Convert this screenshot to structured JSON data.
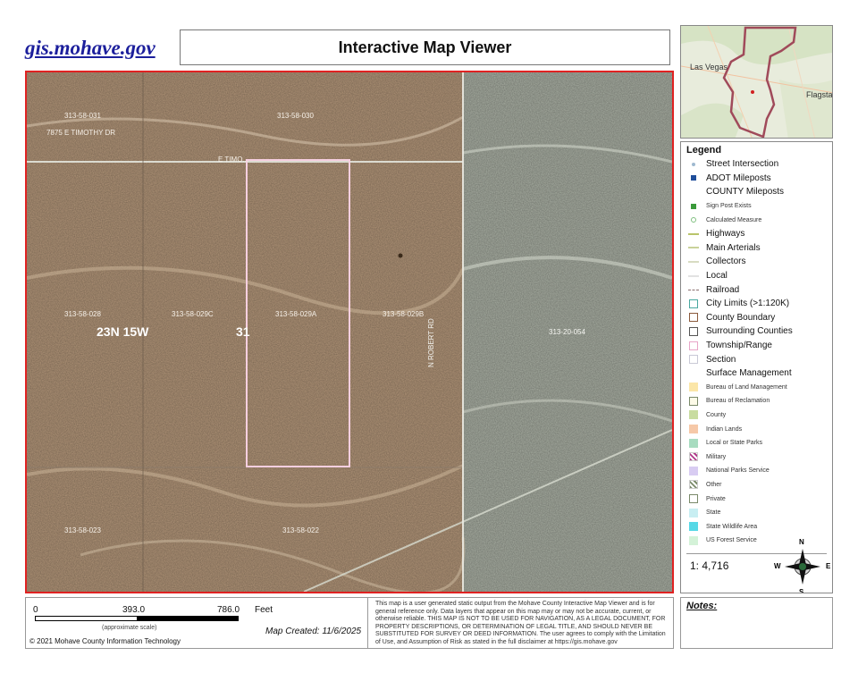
{
  "header": {
    "site_link": "gis.mohave.gov",
    "title": "Interactive Map Viewer"
  },
  "map": {
    "parcels": [
      {
        "id": "313-58-031",
        "pos": "upper-left"
      },
      {
        "id": "313-58-030",
        "pos": "upper-middle"
      },
      {
        "id": "313-58-028",
        "pos": "middle-left"
      },
      {
        "id": "313-58-029C",
        "pos": "middle-left-center"
      },
      {
        "id": "313-58-029A",
        "pos": "middle-center"
      },
      {
        "id": "313-58-029B",
        "pos": "middle-right"
      },
      {
        "id": "313-20-054",
        "pos": "right"
      },
      {
        "id": "313-58-023",
        "pos": "lower-left"
      },
      {
        "id": "313-58-022",
        "pos": "lower-middle"
      }
    ],
    "address_label": "7875 E TIMOTHY DR",
    "street_label": "E TIMO...",
    "road_label": "N ROBERT RD",
    "township_label": "23N 15W",
    "section_label": "31",
    "colors": {
      "border": "#e02222",
      "selection": "#f4c4d8",
      "blm_tint": "#b89a7c",
      "reclamation_tint": "#a8aca0"
    }
  },
  "legend": {
    "title": "Legend",
    "items": [
      {
        "label": "Street Intersection",
        "sym": "dot",
        "color": "#9fb9d0",
        "kind": "main"
      },
      {
        "label": "ADOT Mileposts",
        "sym": "sq",
        "color": "#1f4e9a",
        "kind": "main"
      },
      {
        "label": "COUNTY Mileposts",
        "sym": "none",
        "color": "",
        "kind": "main"
      },
      {
        "label": "Sign Post Exists",
        "sym": "sq",
        "color": "#3b9a3b",
        "kind": "sub"
      },
      {
        "label": "Calculated Measure",
        "sym": "ring",
        "color": "#7fbf7f",
        "kind": "sub"
      },
      {
        "label": "Highways",
        "sym": "line",
        "color": "#b9c46a",
        "kind": "main"
      },
      {
        "label": "Main Arterials",
        "sym": "line",
        "color": "#c9d29a",
        "kind": "main"
      },
      {
        "label": "Collectors",
        "sym": "line",
        "color": "#d8dcc2",
        "kind": "main"
      },
      {
        "label": "Local",
        "sym": "line",
        "color": "#e2e2e2",
        "kind": "main"
      },
      {
        "label": "Railroad",
        "sym": "rail",
        "color": "#8b6f6f",
        "kind": "main"
      },
      {
        "label": "City Limits (>1:120K)",
        "sym": "box",
        "color": "#4aa8a0",
        "kind": "main"
      },
      {
        "label": "County Boundary",
        "sym": "box",
        "color": "#8b5a3c",
        "kind": "main"
      },
      {
        "label": "Surrounding Counties",
        "sym": "box",
        "color": "#555555",
        "kind": "main"
      },
      {
        "label": "Township/Range",
        "sym": "box",
        "color": "#e8a6c8",
        "kind": "main"
      },
      {
        "label": "Section",
        "sym": "box",
        "color": "#c9c9d6",
        "kind": "main"
      },
      {
        "label": "Surface Management",
        "sym": "none",
        "color": "",
        "kind": "main"
      },
      {
        "label": "Bureau of Land Management",
        "sym": "fill",
        "color": "#fbe6a8",
        "kind": "sub2"
      },
      {
        "label": "Bureau of Reclamation",
        "sym": "fillb",
        "color": "#fdfbe8",
        "kind": "sub2"
      },
      {
        "label": "County",
        "sym": "fill",
        "color": "#c8dca0",
        "kind": "sub2"
      },
      {
        "label": "Indian Lands",
        "sym": "fill",
        "color": "#f6c8a8",
        "kind": "sub2"
      },
      {
        "label": "Local or State Parks",
        "sym": "fill",
        "color": "#a8dcc0",
        "kind": "sub2"
      },
      {
        "label": "Military",
        "sym": "hatch",
        "color": "#b03a8a",
        "kind": "sub2"
      },
      {
        "label": "National Parks Service",
        "sym": "fill",
        "color": "#d8ccf2",
        "kind": "sub2"
      },
      {
        "label": "Other",
        "sym": "hatch",
        "color": "#7a8a6a",
        "kind": "sub2"
      },
      {
        "label": "Private",
        "sym": "fillb",
        "color": "#ffffff",
        "kind": "sub2"
      },
      {
        "label": "State",
        "sym": "fill",
        "color": "#c8eef2",
        "kind": "sub2"
      },
      {
        "label": "State Wildlife Area",
        "sym": "fill",
        "color": "#56d8e6",
        "kind": "sub2"
      },
      {
        "label": "US Forest Service",
        "sym": "fill",
        "color": "#d4f2d8",
        "kind": "sub2"
      }
    ],
    "scale_ratio": "1: 4,716"
  },
  "inset": {
    "city1": "Las Vegas",
    "city2": "Flagsta"
  },
  "north_arrow": {
    "n": "N",
    "s": "S",
    "e": "E",
    "w": "W"
  },
  "footer": {
    "scale_zero": "0",
    "scale_mid": "393.0",
    "scale_end": "786.0",
    "scale_units": "Feet",
    "approx": "(approximate scale)",
    "copyright": "© 2021 Mohave County Information Technology",
    "created": "Map Created: 11/6/2025",
    "disclaimer": "This map is a user generated static output from the Mohave County Interactive Map Viewer and is for general reference only. Data layers that appear on this map may or may not be accurate, current, or otherwise reliable. THIS MAP IS NOT TO BE USED FOR NAVIGATION, AS A LEGAL DOCUMENT, FOR PROPERTY DESCRIPTIONS, OR DETERMINATION OF LEGAL TITLE, AND SHOULD NEVER BE SUBSTITUTED FOR SURVEY OR DEED INFORMATION. The user agrees to comply with the Limitation of Use, and Assumption of Risk as stated in the full disclaimer at https://gis.mohave.gov",
    "notes_label": "Notes:"
  }
}
